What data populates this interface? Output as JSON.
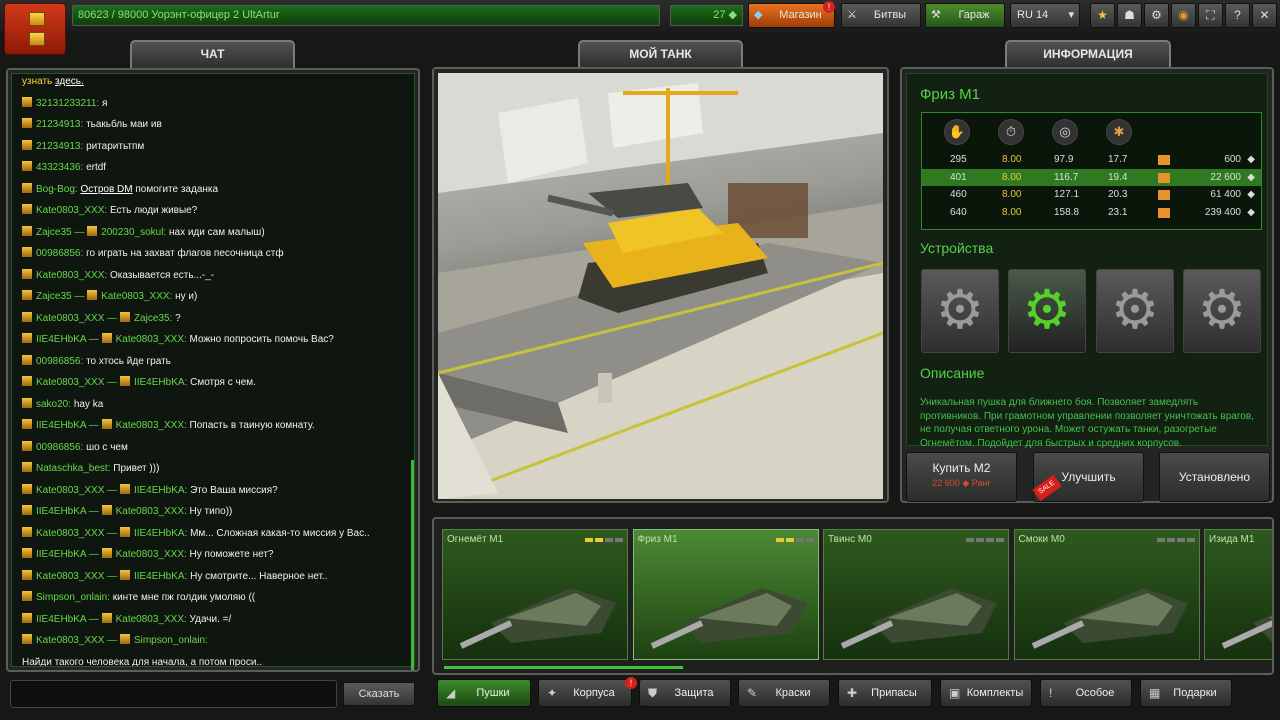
{
  "top": {
    "rank_text": "80623 / 98000  Уорэнт-офицер 2 UltArtur",
    "crystals": "27",
    "shop_label": "Магазин",
    "battles_label": "Битвы",
    "garage_label": "Гараж",
    "server": "RU 14",
    "shop_badge": "!"
  },
  "tabs": {
    "chat": "ЧАТ",
    "mytank": "МОЙ ТАНК",
    "info": "ИНФОРМАЦИЯ"
  },
  "chat": {
    "say_label": "Сказать",
    "messages": [
      {
        "from": "",
        "to": "",
        "text": "узнать ",
        "link": "здесь."
      },
      {
        "from": "32131233211:",
        "to": "",
        "text": "я"
      },
      {
        "from": "21234913:",
        "to": "",
        "text": "тьакьбль маи ив"
      },
      {
        "from": "21234913:",
        "to": "",
        "text": "ритаритьтпм"
      },
      {
        "from": "43323436:",
        "to": "",
        "text": "ertdf"
      },
      {
        "from": "Bog-Bog:",
        "to": "",
        "text": "помогите заданка",
        "link": "Остров DM"
      },
      {
        "from": "Kate0803_XXX:",
        "to": "",
        "text": "Есть люди живые?"
      },
      {
        "from": "Zajce35 —",
        "to": "200230_sokul:",
        "text": "нах иди сам малыш)"
      },
      {
        "from": "00986856:",
        "to": "",
        "text": "го играть на захват флагов песочница стф"
      },
      {
        "from": "Kate0803_XXX:",
        "to": "",
        "text": "Оказывается есть...-_-"
      },
      {
        "from": "Zajce35 —",
        "to": "Kate0803_XXX:",
        "text": "ну и)"
      },
      {
        "from": "Kate0803_XXX —",
        "to": "Zajce35:",
        "text": "?"
      },
      {
        "from": "IIE4EHbKA —",
        "to": "Kate0803_XXX:",
        "text": "Можно попросить помочь Вас?"
      },
      {
        "from": "00986856:",
        "to": "",
        "text": "то хтось йде грать"
      },
      {
        "from": "Kate0803_XXX —",
        "to": "IIE4EHbKA:",
        "text": "Смотря с чем."
      },
      {
        "from": "sako20:",
        "to": "",
        "text": "hay ka"
      },
      {
        "from": "IIE4EHbKA —",
        "to": "Kate0803_XXX:",
        "text": "Попасть в таиную комнату."
      },
      {
        "from": "00986856:",
        "to": "",
        "text": "шо с чем"
      },
      {
        "from": "Nataschka_best:",
        "to": "",
        "text": "Привет )))"
      },
      {
        "from": "Kate0803_XXX —",
        "to": "IIE4EHbKA:",
        "text": "Это Ваша миссия?"
      },
      {
        "from": "IIE4EHbKA —",
        "to": "Kate0803_XXX:",
        "text": "Ну типо))"
      },
      {
        "from": "Kate0803_XXX —",
        "to": "IIE4EHbKA:",
        "text": "Мм... Сложная какая-то миссия у Вас.."
      },
      {
        "from": "IIE4EHbKA —",
        "to": "Kate0803_XXX:",
        "text": "Ну поможете нет?"
      },
      {
        "from": "Kate0803_XXX —",
        "to": "IIE4EHbKA:",
        "text": "Ну смотрите... Наверное нет.."
      },
      {
        "from": "Simpson_onlain:",
        "to": "",
        "text": "кинте мне пж голдик умоляю (("
      },
      {
        "from": "IIE4EHbKA —",
        "to": "Kate0803_XXX:",
        "text": "Удачи. =/"
      },
      {
        "from": "Kate0803_XXX —",
        "to": "Simpson_onlain:",
        "text": ""
      },
      {
        "from": "",
        "to": "",
        "text": "Найди такого человека для начала, а потом проси.."
      }
    ]
  },
  "info": {
    "title": "Фриз М1",
    "stats_header_icons": [
      "damage-icon",
      "reload-icon",
      "range-icon",
      "impact-icon"
    ],
    "stats": [
      {
        "dmg": "295",
        "rel": "8.00",
        "rng": "97.9",
        "imp": "17.7",
        "price": "600"
      },
      {
        "dmg": "401",
        "rel": "8.00",
        "rng": "116.7",
        "imp": "19.4",
        "price": "22 600"
      },
      {
        "dmg": "460",
        "rel": "8.00",
        "rng": "127.1",
        "imp": "20.3",
        "price": "61 400"
      },
      {
        "dmg": "640",
        "rel": "8.00",
        "rng": "158.8",
        "imp": "23.1",
        "price": "239 400"
      }
    ],
    "devices_title": "Устройства",
    "desc_title": "Описание",
    "description": "Уникальная пушка для ближнего боя. Позволяет замедлять противников. При грамотном управлении позволяет уничтожать врагов, не получая ответного урона. Может остужать танки, разогретые Огнемётом. Подойдет для быстрых и средних корпусов.",
    "buy_label": "Купить М2",
    "buy_price_crystals": "22 600",
    "buy_price_rank": "Ранг",
    "upgrade_label": "Улучшить",
    "installed_label": "Установлено",
    "sale_badge": "SALE"
  },
  "cards": [
    {
      "name": "Огнемёт М1"
    },
    {
      "name": "Фриз М1"
    },
    {
      "name": "Твинс М0"
    },
    {
      "name": "Смоки М0"
    },
    {
      "name": "Изида М1"
    }
  ],
  "categories": [
    "Пушки",
    "Корпуса",
    "Защита",
    "Краски",
    "Припасы",
    "Комплекты",
    "Особое",
    "Подарки"
  ]
}
